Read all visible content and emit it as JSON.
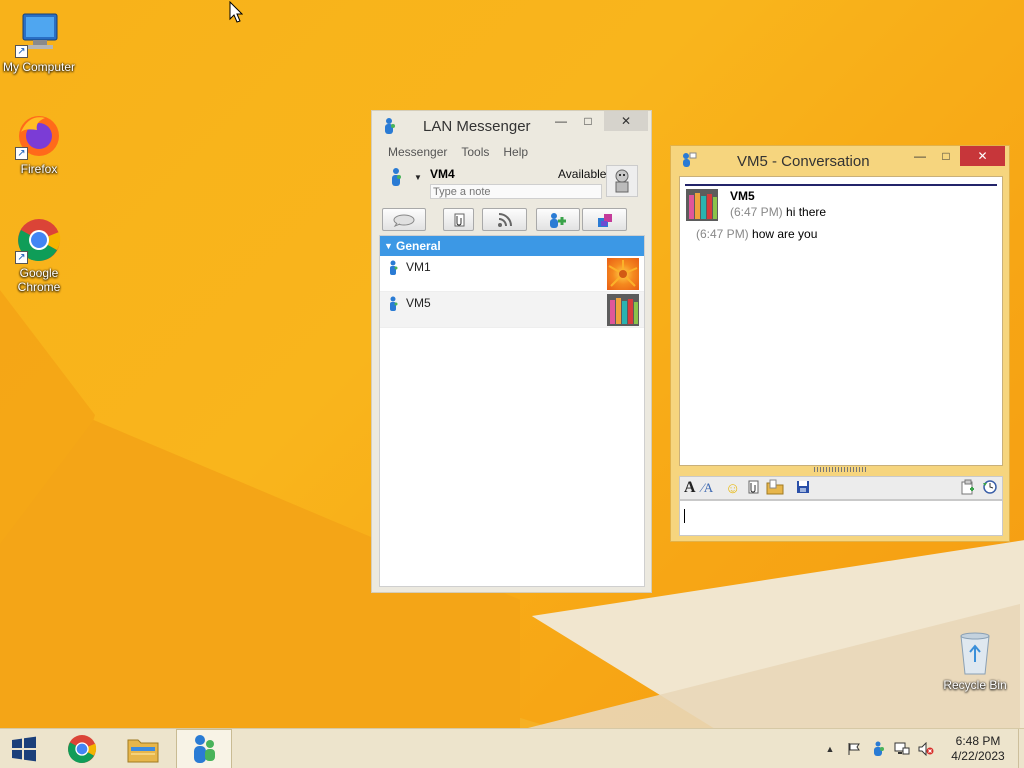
{
  "desktop": {
    "icons": [
      {
        "label": "My Computer",
        "icon": "computer-icon"
      },
      {
        "label": "Firefox",
        "icon": "firefox-icon"
      },
      {
        "label": "Google Chrome",
        "icon": "chrome-icon"
      },
      {
        "label": "Recycle Bin",
        "icon": "recycle-bin-icon"
      }
    ]
  },
  "lan_window": {
    "title": "LAN Messenger",
    "minimize": "—",
    "maximize": "□",
    "close": "✕",
    "menu": [
      "Messenger",
      "Tools",
      "Help"
    ],
    "user_name": "VM4",
    "status": "Available",
    "note_placeholder": "Type a note",
    "group_name": "General",
    "contacts": [
      {
        "name": "VM1"
      },
      {
        "name": "VM5"
      }
    ]
  },
  "conv_window": {
    "title": "VM5 - Conversation",
    "minimize": "—",
    "maximize": "□",
    "close": "✕",
    "sender": "VM5",
    "messages": [
      {
        "time": "(6:47 PM)",
        "text": "hi there"
      },
      {
        "time": "(6:47 PM)",
        "text": "how are you"
      }
    ]
  },
  "taskbar": {
    "time": "6:48 PM",
    "date": "4/22/2023"
  },
  "colors": {
    "wallpaper": "#f8b21a",
    "group_header": "#3c98e5",
    "close_button": "#c7363a",
    "conversation_frame": "#f6d57e"
  }
}
